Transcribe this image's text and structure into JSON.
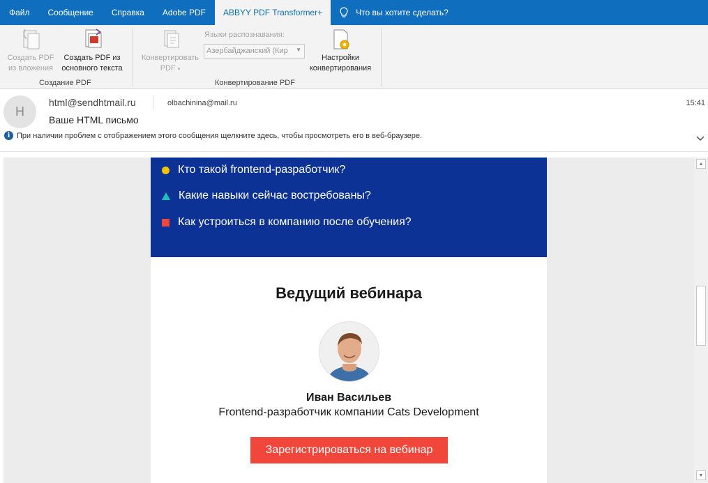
{
  "tabs": [
    {
      "label": "Файл"
    },
    {
      "label": "Сообщение"
    },
    {
      "label": "Справка"
    },
    {
      "label": "Adobe PDF"
    },
    {
      "label": "ABBYY PDF Transformer+"
    }
  ],
  "tell_me": "Что вы хотите сделать?",
  "ribbon": {
    "create_from_attach": {
      "line1": "Создать PDF",
      "line2": "из вложения"
    },
    "create_from_text": {
      "line1": "Создать PDF из",
      "line2": "основного текста"
    },
    "group1_label": "Создание PDF",
    "convert": {
      "line1": "Конвертировать",
      "line2": "PDF"
    },
    "languages_label": "Языки распознавания:",
    "languages_value": "Азербайджанский (Кир",
    "settings": {
      "line1": "Настройки",
      "line2": "конвертирования"
    },
    "group2_label": "Конвертирование PDF"
  },
  "message": {
    "avatar_letter": "H",
    "from": "html@sendhtmail.ru",
    "to": "olbachinina@mail.ru",
    "time": "15:41",
    "subject": "Ваше HTML письмо",
    "info_bar": "При наличии проблем с отображением этого сообщения щелкните здесь, чтобы просмотреть его в веб-браузере."
  },
  "email": {
    "bullets": [
      {
        "text": "Кто такой frontend-разработчик?",
        "marker": "circle",
        "color": "#f5c400"
      },
      {
        "text": "Какие навыки сейчас востребованы?",
        "marker": "triangle",
        "color": "#19c2b8"
      },
      {
        "text": "Как устроиться в компанию после обучения?",
        "marker": "square",
        "color": "#f0473a"
      }
    ],
    "host_title": "Ведущий вебинара",
    "host_name": "Иван Васильев",
    "host_role": "Frontend-разработчик компании Cats Development",
    "cta": "Зарегистрироваться на вебинар"
  },
  "colors": {
    "tab_bar": "#106ebe",
    "email_blue": "#0d3295",
    "cta": "#f0473a"
  }
}
